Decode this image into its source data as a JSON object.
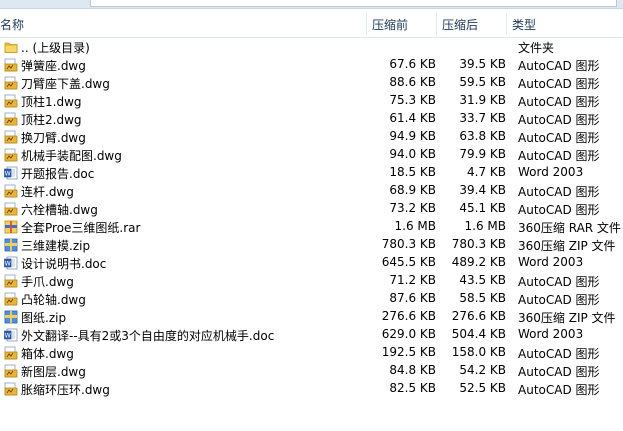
{
  "header": {
    "name": "名称",
    "size": "压缩前",
    "compressed": "压缩后",
    "type": "类型"
  },
  "files": [
    {
      "name": ".. (上级目录)",
      "size": "",
      "compressed": "",
      "type": "文件夹",
      "icon": "folder-icon"
    },
    {
      "name": "弹簧座.dwg",
      "size": "67.6 KB",
      "compressed": "39.5 KB",
      "type": "AutoCAD 图形",
      "icon": "dwg-file-icon"
    },
    {
      "name": "刀臂座下盖.dwg",
      "size": "88.6 KB",
      "compressed": "59.5 KB",
      "type": "AutoCAD 图形",
      "icon": "dwg-file-icon"
    },
    {
      "name": "顶柱1.dwg",
      "size": "75.3 KB",
      "compressed": "31.9 KB",
      "type": "AutoCAD 图形",
      "icon": "dwg-file-icon"
    },
    {
      "name": "顶柱2.dwg",
      "size": "61.4 KB",
      "compressed": "33.7 KB",
      "type": "AutoCAD 图形",
      "icon": "dwg-file-icon"
    },
    {
      "name": "换刀臂.dwg",
      "size": "94.9 KB",
      "compressed": "63.8 KB",
      "type": "AutoCAD 图形",
      "icon": "dwg-file-icon"
    },
    {
      "name": "机械手装配图.dwg",
      "size": "94.0 KB",
      "compressed": "79.9 KB",
      "type": "AutoCAD 图形",
      "icon": "dwg-file-icon"
    },
    {
      "name": "开题报告.doc",
      "size": "18.5 KB",
      "compressed": "4.7 KB",
      "type": "Word 2003",
      "icon": "word-file-icon"
    },
    {
      "name": "连杆.dwg",
      "size": "68.9 KB",
      "compressed": "39.4 KB",
      "type": "AutoCAD 图形",
      "icon": "dwg-file-icon"
    },
    {
      "name": "六栓槽轴.dwg",
      "size": "73.2 KB",
      "compressed": "45.1 KB",
      "type": "AutoCAD 图形",
      "icon": "dwg-file-icon"
    },
    {
      "name": "全套Proe三维图纸.rar",
      "size": "1.6 MB",
      "compressed": "1.6 MB",
      "type": "360压缩 RAR 文件",
      "icon": "rar-file-icon"
    },
    {
      "name": "三维建模.zip",
      "size": "780.3 KB",
      "compressed": "780.3 KB",
      "type": "360压缩 ZIP 文件",
      "icon": "zip-file-icon"
    },
    {
      "name": "设计说明书.doc",
      "size": "645.5 KB",
      "compressed": "489.2 KB",
      "type": "Word 2003",
      "icon": "word-file-icon"
    },
    {
      "name": "手爪.dwg",
      "size": "71.2 KB",
      "compressed": "43.5 KB",
      "type": "AutoCAD 图形",
      "icon": "dwg-file-icon"
    },
    {
      "name": "凸轮轴.dwg",
      "size": "87.6 KB",
      "compressed": "58.5 KB",
      "type": "AutoCAD 图形",
      "icon": "dwg-file-icon"
    },
    {
      "name": "图纸.zip",
      "size": "276.6 KB",
      "compressed": "276.6 KB",
      "type": "360压缩 ZIP 文件",
      "icon": "zip-file-icon"
    },
    {
      "name": "外文翻译--具有2或3个自由度的对应机械手.doc",
      "size": "629.0 KB",
      "compressed": "504.4 KB",
      "type": "Word 2003",
      "icon": "word-file-icon"
    },
    {
      "name": "箱体.dwg",
      "size": "192.5 KB",
      "compressed": "158.0 KB",
      "type": "AutoCAD 图形",
      "icon": "dwg-file-icon"
    },
    {
      "name": "新图层.dwg",
      "size": "84.8 KB",
      "compressed": "54.2 KB",
      "type": "AutoCAD 图形",
      "icon": "dwg-file-icon"
    },
    {
      "name": "胀缩环压环.dwg",
      "size": "82.5 KB",
      "compressed": "52.5 KB",
      "type": "AutoCAD 图形",
      "icon": "dwg-file-icon"
    }
  ]
}
